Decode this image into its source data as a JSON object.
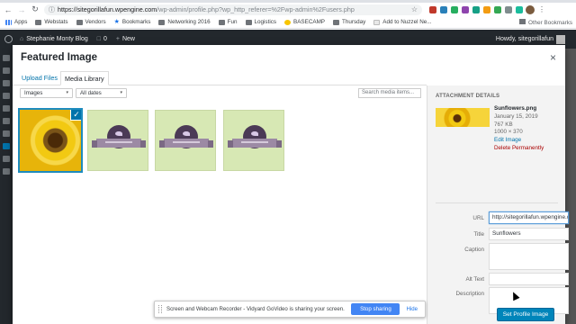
{
  "browser": {
    "url_host": "https://sitegorillafun.wpengine.com",
    "url_path": "/wp-admin/profile.php?wp_http_referer=%2Fwp-admin%2Fusers.php",
    "bookmarks": [
      {
        "label": "Apps",
        "icon": "apps-grid-icon"
      },
      {
        "label": "Webstats",
        "icon": "folder-icon"
      },
      {
        "label": "Vendors",
        "icon": "folder-icon"
      },
      {
        "label": "Bookmarks",
        "icon": "star-icon"
      },
      {
        "label": "Networking 2016",
        "icon": "folder-icon"
      },
      {
        "label": "Fun",
        "icon": "folder-icon"
      },
      {
        "label": "Logistics",
        "icon": "folder-icon"
      },
      {
        "label": "BASECAMP",
        "icon": "basecamp-icon"
      },
      {
        "label": "Thursday",
        "icon": "folder-icon"
      },
      {
        "label": "Add to Nuzzel Ne...",
        "icon": "nuzzel-icon"
      }
    ],
    "other_bookmarks": "Other Bookmarks",
    "ext_colors": [
      "#c0392b",
      "#2980b9",
      "#27ae60",
      "#8e44ad",
      "#16a085",
      "#f39c12",
      "#34a853",
      "#7f8c8d",
      "#1abc9c"
    ]
  },
  "adminbar": {
    "site_name": "Stephanie Monty Blog",
    "comments_count": "0",
    "new_label": "New",
    "howdy": "Howdy, sitegorillafun"
  },
  "modal": {
    "title": "Featured Image",
    "close": "×",
    "tabs": {
      "upload": "Upload Files",
      "library": "Media Library"
    },
    "filters": {
      "type": "Images",
      "date": "All dates",
      "search_placeholder": "Search media items..."
    }
  },
  "attachment_details": {
    "heading": "ATTACHMENT DETAILS",
    "filename": "Sunflowers.png",
    "date": "January 15, 2019",
    "filesize": "767 KB",
    "dimensions": "1000 × 370",
    "edit_link": "Edit Image",
    "delete_link": "Delete Permanently",
    "fields": {
      "url_label": "URL",
      "url_value": "http://sitegorillafun.wpengine.com/",
      "title_label": "Title",
      "title_value": "Sunflowers",
      "caption_label": "Caption",
      "caption_value": "",
      "alt_label": "Alt Text",
      "alt_value": "",
      "description_label": "Description",
      "description_value": ""
    }
  },
  "share_bar": {
    "message": "Screen and Webcam Recorder - Vidyard GoVideo is sharing your screen.",
    "stop_label": "Stop sharing",
    "hide_label": "Hide"
  },
  "set_button": "Set Profile Image"
}
